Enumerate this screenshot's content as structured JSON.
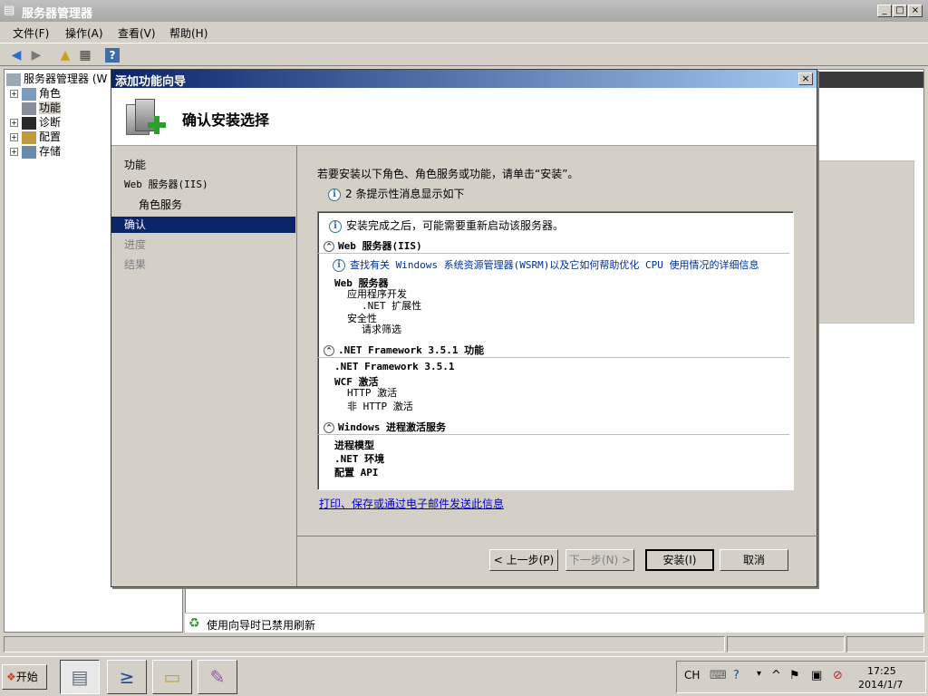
{
  "window": {
    "title": "服务器管理器",
    "min_label": "_",
    "max_label": "□",
    "close_label": "×"
  },
  "menu": [
    "文件(F)",
    "操作(A)",
    "查看(V)",
    "帮助(H)"
  ],
  "tree": {
    "root": "服务器管理器 (W",
    "items": [
      "角色",
      "功能",
      "诊断",
      "配置",
      "存储"
    ]
  },
  "status_line": "使用向导时已禁用刷新",
  "dialog": {
    "title": "添加功能向导",
    "close_label": "×",
    "header": "确认安装选择",
    "steps": [
      {
        "label": "功能"
      },
      {
        "label": "Web 服务器(IIS)"
      },
      {
        "label": "角色服务"
      },
      {
        "label": "确认"
      },
      {
        "label": "进度"
      },
      {
        "label": "结果"
      }
    ],
    "instruction": "若要安装以下角色、角色服务或功能，请单击“安装”。",
    "info_count": "2 条提示性消息显示如下",
    "info_icon": "i",
    "list": {
      "restart_msg": "安装完成之后，可能需要重新启动该服务器。",
      "sections": [
        {
          "title": "Web 服务器(IIS)",
          "link": "查找有关 Windows 系统资源管理器(WSRM)以及它如何帮助优化 CPU 使用情况的详细信息",
          "lines": [
            "Web 服务器",
            "应用程序开发",
            ".NET 扩展性",
            "安全性",
            "请求筛选"
          ]
        },
        {
          "title": ".NET Framework 3.5.1 功能",
          "lines": [
            ".NET Framework 3.5.1",
            "WCF 激活",
            "HTTP 激活",
            "非 HTTP 激活"
          ]
        },
        {
          "title": "Windows 进程激活服务",
          "lines": [
            "进程模型",
            ".NET 环境",
            "配置 API"
          ]
        }
      ]
    },
    "print_link": "打印、保存或通过电子邮件发送此信息",
    "buttons": {
      "prev": "< 上一步(P)",
      "next": "下一步(N) >",
      "install": "安装(I)",
      "cancel": "取消"
    }
  },
  "taskbar": {
    "start": "开始",
    "tray": {
      "lang": "CH",
      "time": "17:25",
      "date": "2014/1/7"
    }
  }
}
